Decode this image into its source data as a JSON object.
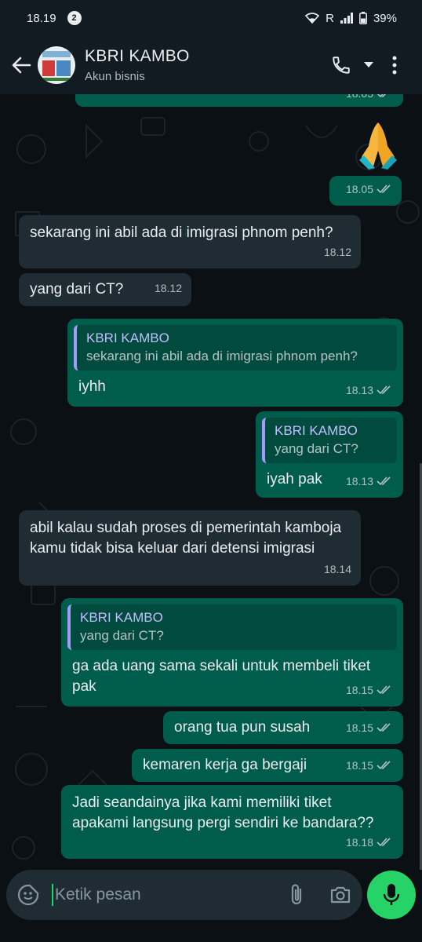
{
  "status_bar": {
    "time": "18.19",
    "notification_count": "2",
    "roaming": "R",
    "battery": "39%"
  },
  "header": {
    "contact_name": "KBRI KAMBO",
    "subtitle": "Akun bisnis"
  },
  "colors": {
    "outgoing_bubble": "#005c4b",
    "incoming_bubble": "#1f2c34",
    "accent": "#25d366",
    "quote_bar": "#a59bff"
  },
  "messages": [
    {
      "id": "m0",
      "direction": "out",
      "time": "18.05",
      "partial": true
    },
    {
      "id": "m1",
      "direction": "out",
      "text": "🙏",
      "time": "18.05"
    },
    {
      "id": "m2",
      "direction": "in",
      "text": "sekarang ini abil ada di imigrasi phnom penh?",
      "time": "18.12"
    },
    {
      "id": "m3",
      "direction": "in",
      "text": "yang dari CT?",
      "time": "18.12"
    },
    {
      "id": "m4",
      "direction": "out",
      "quote_author": "KBRI KAMBO",
      "quote_text": "sekarang ini abil ada di imigrasi phnom penh?",
      "text": "iyhh",
      "time": "18.13"
    },
    {
      "id": "m5",
      "direction": "out",
      "quote_author": "KBRI KAMBO",
      "quote_text": "yang dari CT?",
      "text": "iyah pak",
      "time": "18.13"
    },
    {
      "id": "m6",
      "direction": "in",
      "text": "abil kalau sudah proses di pemerintah kamboja kamu tidak bisa keluar dari detensi imigrasi",
      "time": "18.14"
    },
    {
      "id": "m7",
      "direction": "out",
      "quote_author": "KBRI KAMBO",
      "quote_text": "yang dari CT?",
      "text": "ga ada uang sama sekali untuk membeli tiket pak",
      "time": "18.15"
    },
    {
      "id": "m8",
      "direction": "out",
      "text": "orang tua pun susah",
      "time": "18.15"
    },
    {
      "id": "m9",
      "direction": "out",
      "text": "kemaren kerja ga bergaji",
      "time": "18.15"
    },
    {
      "id": "m10",
      "direction": "out",
      "text": "Jadi seandainya jika kami memiliki tiket apakami langsung pergi sendiri ke bandara??",
      "time": "18.18"
    }
  ],
  "composer": {
    "placeholder": "Ketik pesan",
    "icons": [
      "sticker-icon",
      "paperclip-icon",
      "camera-icon",
      "microphone-icon"
    ]
  }
}
